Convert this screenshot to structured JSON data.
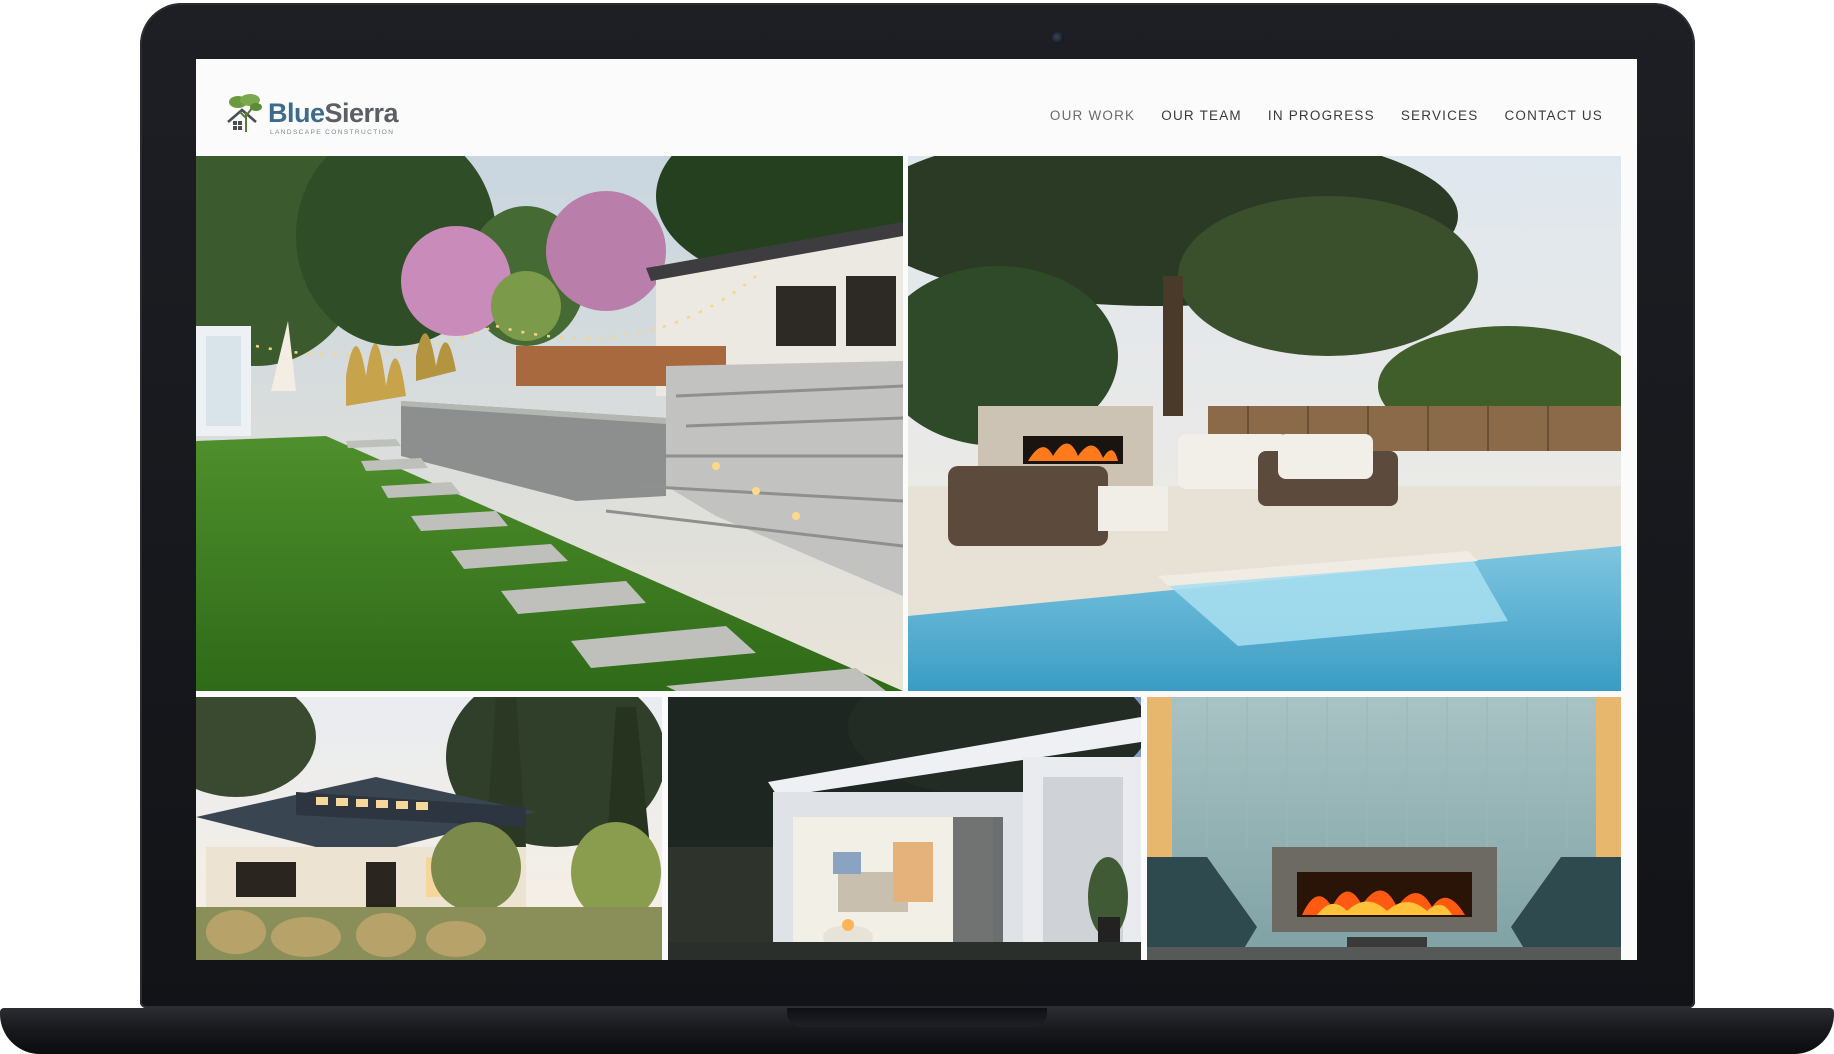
{
  "brand": {
    "name_part1": "Blue",
    "name_part2": "Sierra",
    "tagline": "LANDSCAPE CONSTRUCTION",
    "color_primary": "#3f6b8a",
    "color_secondary": "#5b5e63"
  },
  "nav": {
    "items": [
      {
        "label": "OUR WORK"
      },
      {
        "label": "OUR TEAM"
      },
      {
        "label": "IN PROGRESS"
      },
      {
        "label": "SERVICES"
      },
      {
        "label": "CONTACT US"
      }
    ]
  },
  "gallery": {
    "photos": [
      {
        "subject": "backyard-lawn-steps-string-lights"
      },
      {
        "subject": "pool-patio-fireplace"
      },
      {
        "subject": "house-exterior-metal-roof"
      },
      {
        "subject": "modern-pool-house-dusk"
      },
      {
        "subject": "outdoor-fireplace-lounge"
      }
    ]
  }
}
